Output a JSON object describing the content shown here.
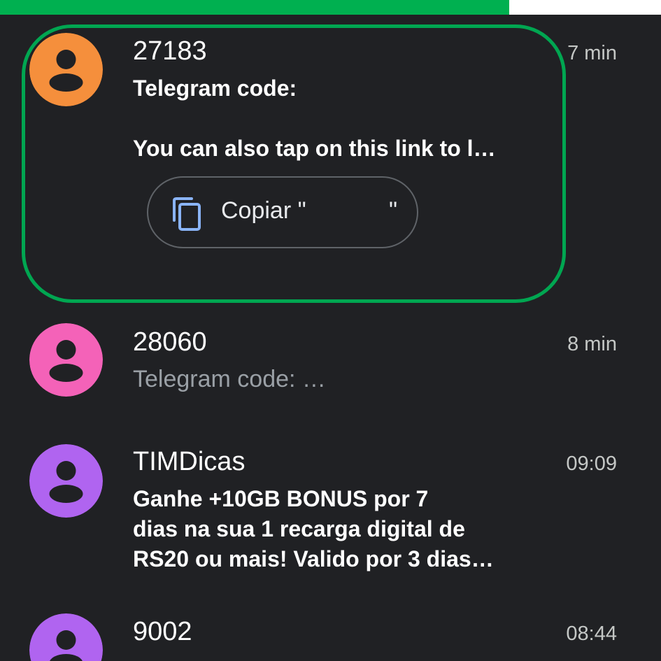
{
  "status": {
    "progress_percent": 77,
    "progress_color": "#00b050"
  },
  "highlight_color": "#00a651",
  "conversations": [
    {
      "sender": "27183",
      "time": "7 min",
      "avatar_color": "#f58f3c",
      "line1": "Telegram code:",
      "line2": "",
      "line3": "You can also tap on this link to l…",
      "unread": true,
      "copy_chip": {
        "icon": "copy-icon",
        "label": "Copiar \"",
        "close_quote": "\""
      }
    },
    {
      "sender": "28060",
      "time": "8 min",
      "avatar_color": "#f462b8",
      "line1": "Telegram code:              …",
      "unread": false
    },
    {
      "sender": "TIMDicas",
      "time": "09:09",
      "avatar_color": "#b064f0",
      "line1": "Ganhe +10GB BONUS por 7",
      "line2": "dias na sua 1 recarga digital de",
      "line3": "RS20 ou mais! Valido por 3 dias…",
      "unread": true
    },
    {
      "sender": "9002",
      "time": "08:44",
      "avatar_color": "#b064f0",
      "unread": true
    }
  ]
}
